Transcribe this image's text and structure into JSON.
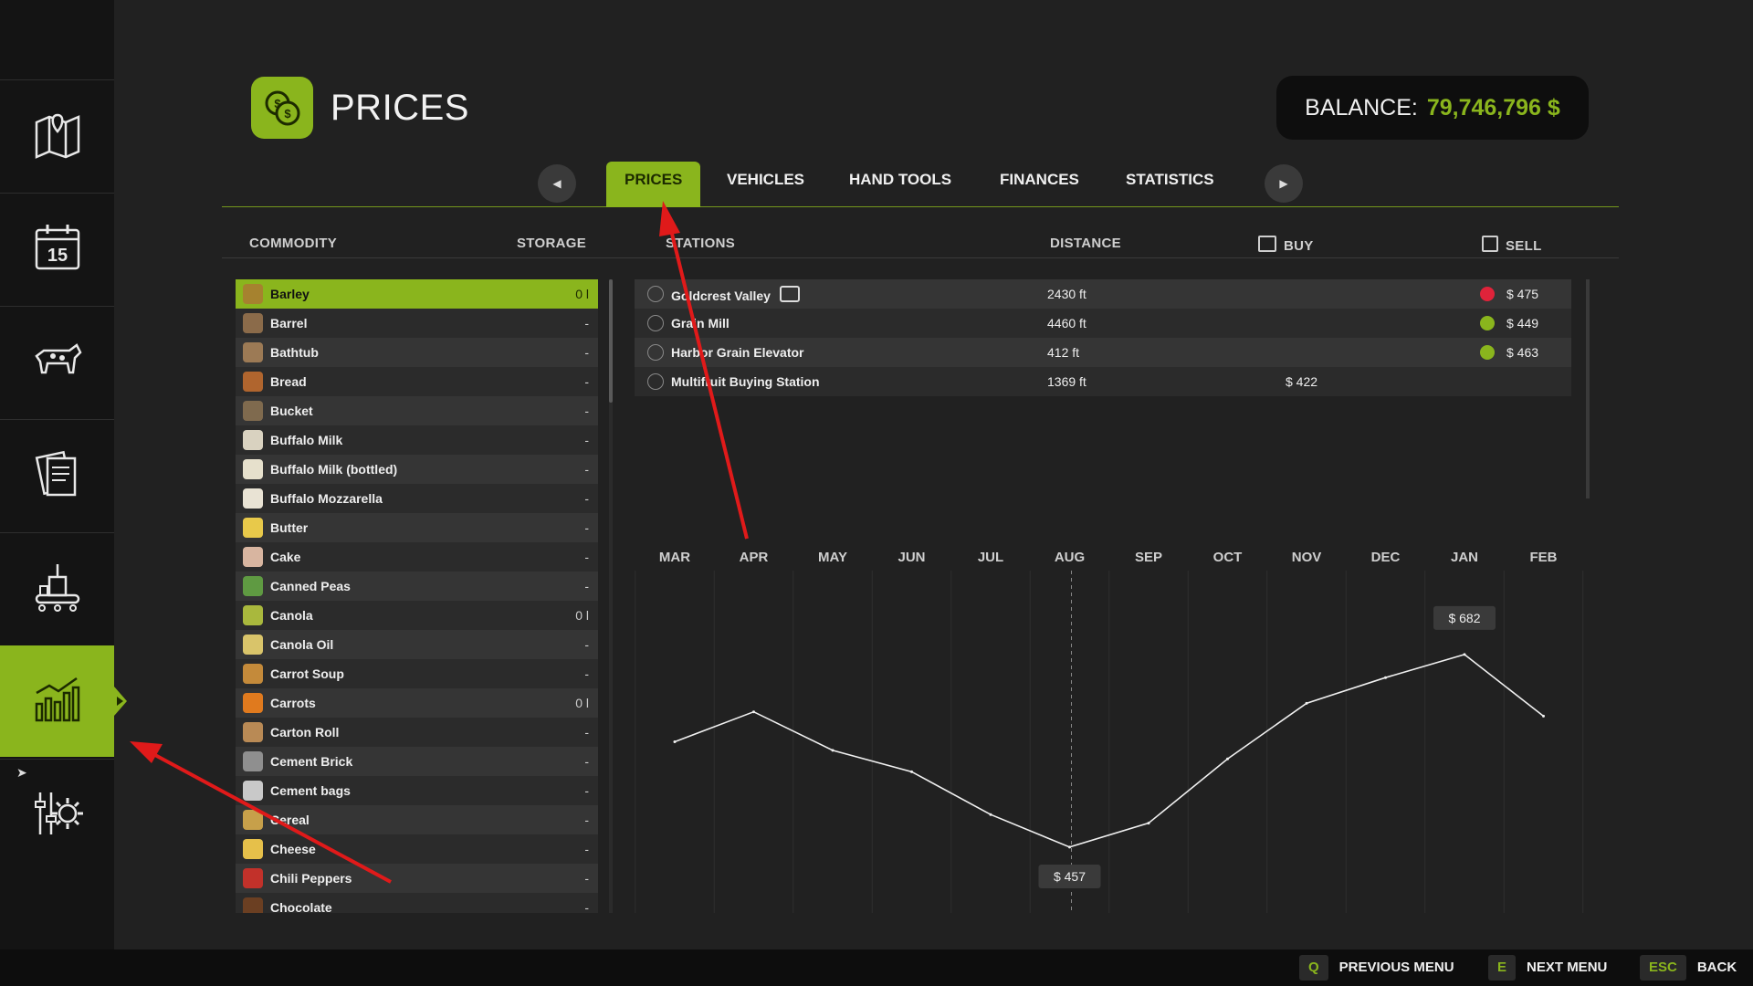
{
  "page": {
    "title": "PRICES",
    "icon": "coins-icon"
  },
  "balance": {
    "label": "BALANCE:",
    "value": "79,746,796 $"
  },
  "sidebar": {
    "items": [
      {
        "icon": "map-icon",
        "active": false
      },
      {
        "icon": "calendar-icon",
        "active": false
      },
      {
        "icon": "animals-icon",
        "active": false
      },
      {
        "icon": "contracts-icon",
        "active": false
      },
      {
        "icon": "production-icon",
        "active": false
      },
      {
        "icon": "chart-icon",
        "active": true
      },
      {
        "icon": "settings-icon",
        "active": false
      }
    ]
  },
  "tabs": [
    {
      "label": "PRICES",
      "active": true
    },
    {
      "label": "VEHICLES",
      "active": false
    },
    {
      "label": "HAND TOOLS",
      "active": false
    },
    {
      "label": "FINANCES",
      "active": false
    },
    {
      "label": "STATISTICS",
      "active": false
    }
  ],
  "columns": {
    "commodity": "COMMODITY",
    "storage": "STORAGE",
    "stations": "STATIONS",
    "distance": "DISTANCE",
    "buy": "BUY",
    "sell": "SELL"
  },
  "commodities": [
    {
      "name": "Barley",
      "storage": "0 l",
      "selected": true
    },
    {
      "name": "Barrel",
      "storage": "-"
    },
    {
      "name": "Bathtub",
      "storage": "-"
    },
    {
      "name": "Bread",
      "storage": "-"
    },
    {
      "name": "Bucket",
      "storage": "-"
    },
    {
      "name": "Buffalo Milk",
      "storage": "-"
    },
    {
      "name": "Buffalo Milk (bottled)",
      "storage": "-"
    },
    {
      "name": "Buffalo Mozzarella",
      "storage": "-"
    },
    {
      "name": "Butter",
      "storage": "-"
    },
    {
      "name": "Cake",
      "storage": "-"
    },
    {
      "name": "Canned Peas",
      "storage": "-"
    },
    {
      "name": "Canola",
      "storage": "0 l"
    },
    {
      "name": "Canola Oil",
      "storage": "-"
    },
    {
      "name": "Carrot Soup",
      "storage": "-"
    },
    {
      "name": "Carrots",
      "storage": "0 l"
    },
    {
      "name": "Carton Roll",
      "storage": "-"
    },
    {
      "name": "Cement Brick",
      "storage": "-"
    },
    {
      "name": "Cement bags",
      "storage": "-"
    },
    {
      "name": "Cereal",
      "storage": "-"
    },
    {
      "name": "Cheese",
      "storage": "-"
    },
    {
      "name": "Chili Peppers",
      "storage": "-"
    },
    {
      "name": "Chocolate",
      "storage": "-"
    }
  ],
  "stations": [
    {
      "name": "Goldcrest Valley",
      "rail": true,
      "distance": "2430 ft",
      "buy": "",
      "trend": "down",
      "sell": "$ 475"
    },
    {
      "name": "Grain Mill",
      "rail": false,
      "distance": "4460 ft",
      "buy": "",
      "trend": "up",
      "sell": "$ 449"
    },
    {
      "name": "Harbor Grain Elevator",
      "rail": false,
      "distance": "412 ft",
      "buy": "",
      "trend": "up",
      "sell": "$ 463"
    },
    {
      "name": "Multifruit Buying Station",
      "rail": false,
      "distance": "1369 ft",
      "buy": "$ 422",
      "trend": "",
      "sell": ""
    }
  ],
  "chart_data": {
    "type": "line",
    "categories": [
      "MAR",
      "APR",
      "MAY",
      "JUN",
      "JUL",
      "AUG",
      "SEP",
      "OCT",
      "NOV",
      "DEC",
      "JAN",
      "FEB"
    ],
    "series": [
      {
        "values": [
          580,
          615,
          570,
          545,
          495,
          457,
          485,
          560,
          625,
          655,
          682,
          610
        ]
      }
    ],
    "current_month": "AUG",
    "annotations": [
      {
        "month": "JAN",
        "label": "$ 682"
      },
      {
        "month": "AUG",
        "label": "$ 457"
      }
    ],
    "ylim": [
      380,
      780
    ],
    "grid": "vertical"
  },
  "footer": {
    "keys": [
      {
        "key": "Q",
        "label": "PREVIOUS MENU"
      },
      {
        "key": "E",
        "label": "NEXT MENU"
      },
      {
        "key": "ESC",
        "label": "BACK"
      }
    ]
  },
  "colors": {
    "accent": "#8ab51d",
    "down": "#e0233a",
    "background": "#212121",
    "annotation_arrow": "#e01a1a"
  }
}
